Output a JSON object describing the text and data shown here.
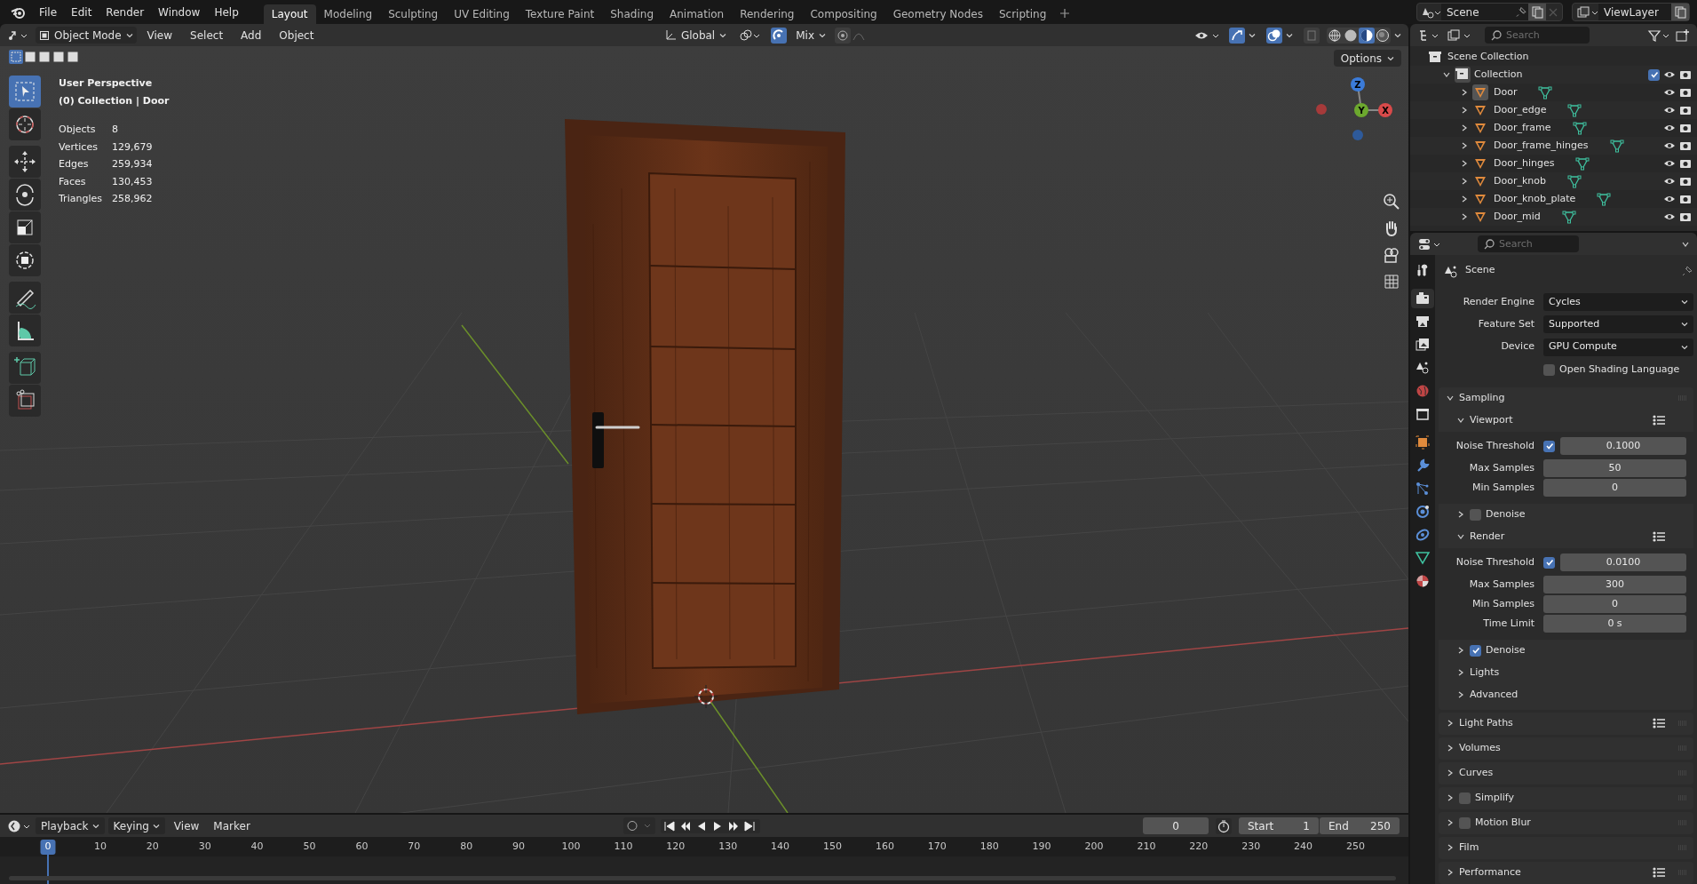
{
  "topbar": {
    "menus": [
      "File",
      "Edit",
      "Render",
      "Window",
      "Help"
    ],
    "workspaces": [
      {
        "label": "Layout",
        "selected": true
      },
      {
        "label": "Modeling",
        "selected": false
      },
      {
        "label": "Sculpting",
        "selected": false
      },
      {
        "label": "UV Editing",
        "selected": false
      },
      {
        "label": "Texture Paint",
        "selected": false
      },
      {
        "label": "Shading",
        "selected": false
      },
      {
        "label": "Animation",
        "selected": false
      },
      {
        "label": "Rendering",
        "selected": false
      },
      {
        "label": "Compositing",
        "selected": false
      },
      {
        "label": "Geometry Nodes",
        "selected": false
      },
      {
        "label": "Scripting",
        "selected": false
      }
    ],
    "scene": "Scene",
    "view_layer": "ViewLayer"
  },
  "viewport": {
    "mode": "Object Mode",
    "menus": [
      "View",
      "Select",
      "Add",
      "Object"
    ],
    "orientation": "Global",
    "snap_target": "Mix",
    "options": "Options",
    "overlay": [
      "User Perspective",
      "(0) Collection | Door"
    ],
    "stats": [
      {
        "label": "Objects",
        "value": "8"
      },
      {
        "label": "Vertices",
        "value": "129,679"
      },
      {
        "label": "Edges",
        "value": "259,934"
      },
      {
        "label": "Faces",
        "value": "130,453"
      },
      {
        "label": "Triangles",
        "value": "258,962"
      }
    ],
    "select_modes": [
      {
        "selected": true
      },
      {
        "selected": false
      },
      {
        "selected": false
      },
      {
        "selected": false
      },
      {
        "selected": false
      }
    ],
    "tools": [
      {
        "kind": "select",
        "selected": true
      },
      {
        "kind": "cursor",
        "selected": false
      },
      {
        "kind": "move",
        "selected": false
      },
      {
        "kind": "rotate",
        "selected": false
      },
      {
        "kind": "scale",
        "selected": false
      },
      {
        "kind": "transform",
        "selected": false
      },
      {
        "kind": "annotate",
        "selected": false
      },
      {
        "kind": "measure",
        "selected": false
      },
      {
        "kind": "add-cube",
        "selected": false
      },
      {
        "kind": "cut",
        "selected": false
      }
    ],
    "shading": [
      {
        "kind": "wireframe",
        "selected": false
      },
      {
        "kind": "solid",
        "selected": false
      },
      {
        "kind": "material",
        "selected": true
      },
      {
        "kind": "rendered",
        "selected": false
      }
    ],
    "gizmo": [
      "Z",
      "Y",
      "X"
    ]
  },
  "outliner": {
    "search": {
      "placeholder": "Search"
    },
    "root": "Scene Collection",
    "collection": {
      "name": "Collection",
      "expanded": true,
      "checked": true,
      "children": [
        {
          "name": "Door",
          "active": true
        },
        {
          "name": "Door_edge",
          "active": false
        },
        {
          "name": "Door_frame",
          "active": false
        },
        {
          "name": "Door_frame_hinges",
          "active": false
        },
        {
          "name": "Door_hinges",
          "active": false
        },
        {
          "name": "Door_knob",
          "active": false
        },
        {
          "name": "Door_knob_plate",
          "active": false
        },
        {
          "name": "Door_mid",
          "active": false
        }
      ]
    }
  },
  "properties": {
    "search": {
      "placeholder": "Search"
    },
    "context": "Scene",
    "tabs": [
      {
        "kind": "tool",
        "selected": false
      },
      {
        "kind": "render",
        "selected": true
      },
      {
        "kind": "output",
        "selected": false
      },
      {
        "kind": "view-layer",
        "selected": false
      },
      {
        "kind": "scene",
        "selected": false
      },
      {
        "kind": "world",
        "selected": false
      },
      {
        "kind": "collection",
        "selected": false
      },
      {
        "kind": "object",
        "selected": false
      },
      {
        "kind": "modifier",
        "selected": false
      },
      {
        "kind": "particles",
        "selected": false
      },
      {
        "kind": "physics",
        "selected": false
      },
      {
        "kind": "constraint",
        "selected": false
      },
      {
        "kind": "data",
        "selected": false
      },
      {
        "kind": "material",
        "selected": false
      }
    ],
    "fields": [
      {
        "label": "Render Engine",
        "value": "Cycles"
      },
      {
        "label": "Feature Set",
        "value": "Supported"
      },
      {
        "label": "Device",
        "value": "GPU Compute"
      }
    ],
    "osl": {
      "label": "Open Shading Language",
      "checked": false
    },
    "sampling": {
      "title": "Sampling",
      "expanded": true,
      "subpanels": [
        {
          "title": "Viewport",
          "expanded": true,
          "presets": true,
          "rows": [
            {
              "label": "Noise Threshold",
              "checked": true,
              "value": "0.1000"
            },
            {
              "label": "Max Samples",
              "value": "50"
            },
            {
              "label": "Min Samples",
              "value": "0"
            }
          ]
        },
        {
          "title": "Denoise",
          "expanded": false,
          "checked": false
        },
        {
          "title": "Render",
          "expanded": true,
          "presets": true,
          "rows": [
            {
              "label": "Noise Threshold",
              "checked": true,
              "value": "0.0100"
            },
            {
              "label": "Max Samples",
              "value": "300"
            },
            {
              "label": "Min Samples",
              "value": "0"
            },
            {
              "label": "Time Limit",
              "value": "0 s"
            }
          ]
        },
        {
          "title": "Denoise",
          "expanded": false,
          "checked": true
        },
        {
          "title": "Lights",
          "expanded": false
        },
        {
          "title": "Advanced",
          "expanded": false
        }
      ]
    },
    "panels": [
      {
        "title": "Light Paths",
        "presets": true
      },
      {
        "title": "Volumes"
      },
      {
        "title": "Curves"
      },
      {
        "title": "Simplify",
        "checked": false
      },
      {
        "title": "Motion Blur",
        "checked": false
      },
      {
        "title": "Film"
      },
      {
        "title": "Performance",
        "presets": true
      }
    ]
  },
  "timeline": {
    "menus": [
      "Playback",
      "Keying",
      "View",
      "Marker"
    ],
    "current_frame": "0",
    "start_label": "Start",
    "start": "1",
    "end_label": "End",
    "end": "250",
    "ticks": [
      "0",
      "10",
      "20",
      "30",
      "40",
      "50",
      "60",
      "70",
      "80",
      "90",
      "100",
      "110",
      "120",
      "130",
      "140",
      "150",
      "160",
      "170",
      "180",
      "190",
      "200",
      "210",
      "220",
      "230",
      "240",
      "250"
    ]
  }
}
